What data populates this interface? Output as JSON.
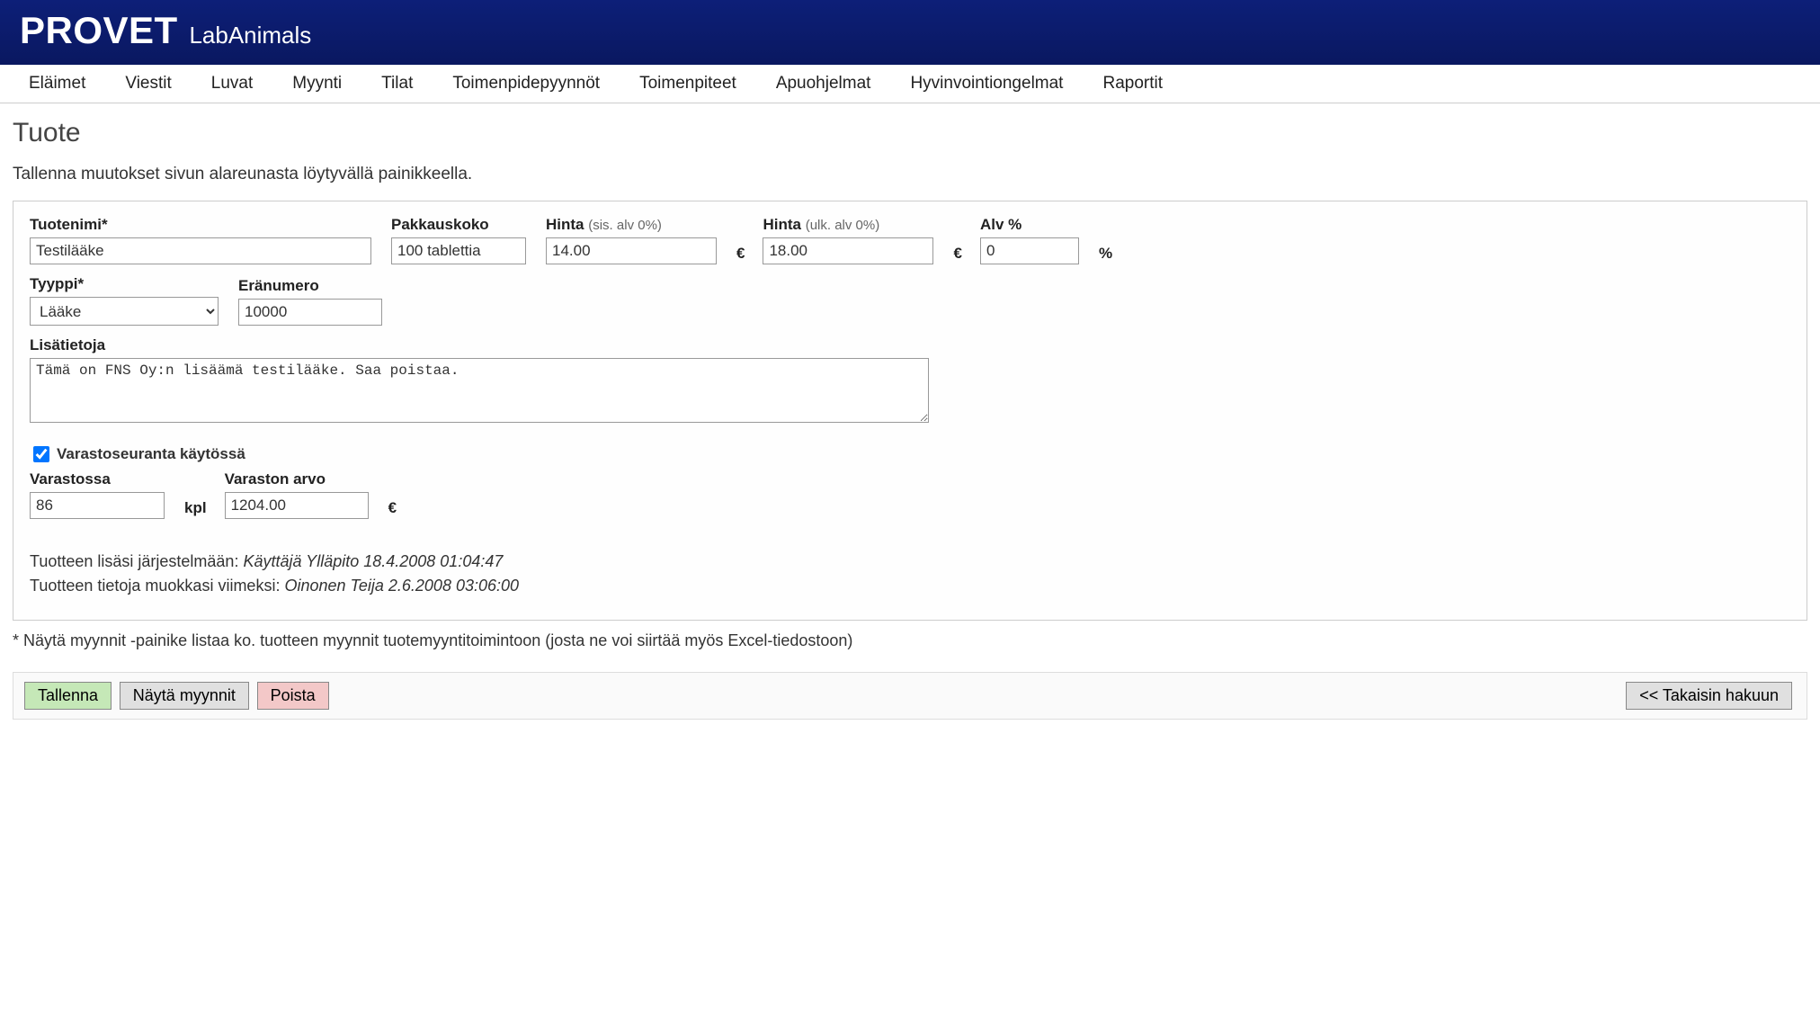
{
  "brand": {
    "main": "PROVET",
    "sub": "LabAnimals"
  },
  "menu": [
    "Eläimet",
    "Viestit",
    "Luvat",
    "Myynti",
    "Tilat",
    "Toimenpidepyynnöt",
    "Toimenpiteet",
    "Apuohjelmat",
    "Hyvinvointiongelmat",
    "Raportit"
  ],
  "page": {
    "title": "Tuote",
    "subtitle": "Tallenna muutokset sivun alareunasta löytyvällä painikkeella."
  },
  "labels": {
    "tuotenimi": "Tuotenimi*",
    "pakkauskoko": "Pakkauskoko",
    "hinta_sis": "Hinta",
    "hinta_sis_sub": "(sis. alv 0%)",
    "hinta_ulk": "Hinta",
    "hinta_ulk_sub": "(ulk. alv 0%)",
    "alv": "Alv %",
    "tyyppi": "Tyyppi*",
    "eranumero": "Eränumero",
    "lisatiedot": "Lisätietoja",
    "varastoseur": "Varastoseuranta käytössä",
    "varastossa": "Varastossa",
    "varaston_arvo": "Varaston arvo",
    "kpl": "kpl",
    "euro": "€",
    "pct": "%"
  },
  "values": {
    "tuotenimi": "Testilääke",
    "pakkauskoko": "100 tablettia",
    "hinta_sis": "14.00",
    "hinta_ulk": "18.00",
    "alv": "0",
    "tyyppi": "Lääke",
    "eranumero": "10000",
    "lisatiedot": "Tämä on FNS Oy:n lisäämä testilääke. Saa poistaa.",
    "varastossa": "86",
    "varaston_arvo": "1204.00"
  },
  "meta": {
    "added_label": "Tuotteen lisäsi järjestelmään:",
    "added_value": "Käyttäjä Ylläpito 18.4.2008 01:04:47",
    "modified_label": "Tuotteen tietoja muokkasi viimeksi:",
    "modified_value": "Oinonen Teija 2.6.2008 03:06:00"
  },
  "footnote": "* Näytä myynnit -painike listaa ko. tuotteen myynnit tuotemyyntitoimintoon (josta ne voi siirtää myös Excel-tiedostoon)",
  "buttons": {
    "save": "Tallenna",
    "show": "Näytä myynnit",
    "delete": "Poista",
    "back": "<< Takaisin hakuun"
  }
}
